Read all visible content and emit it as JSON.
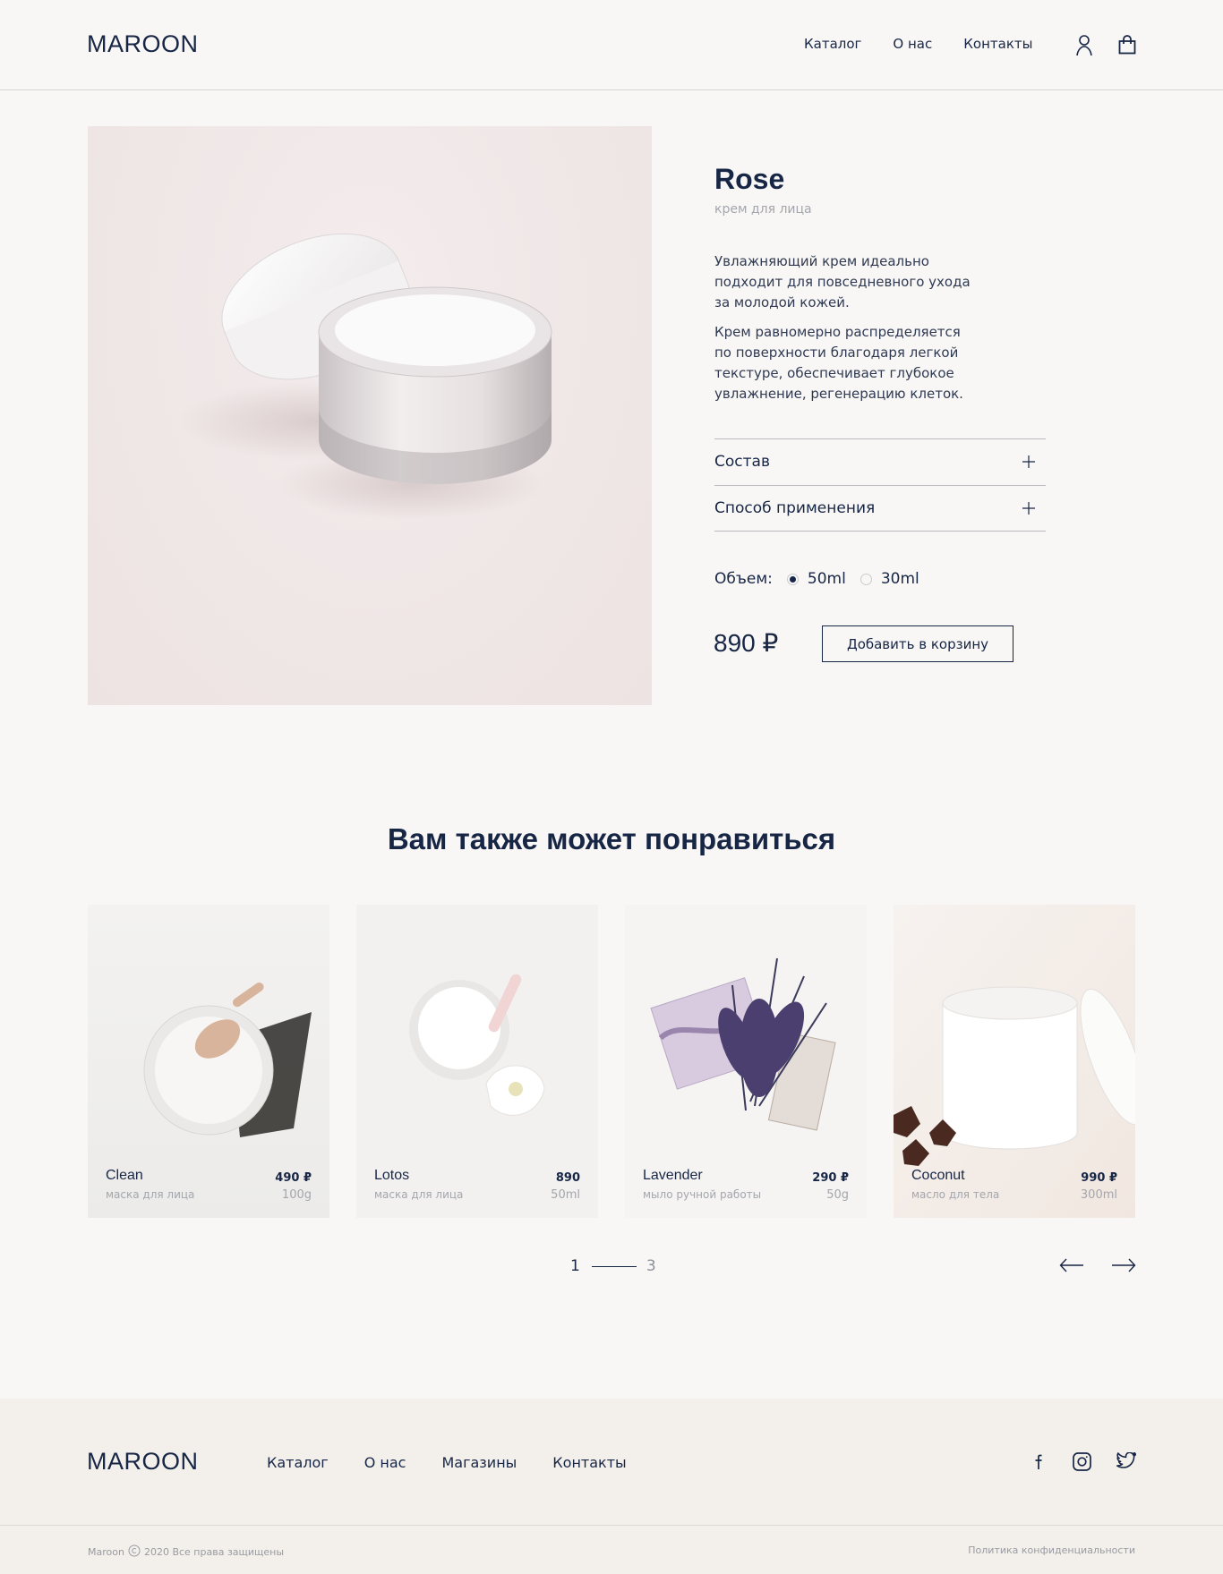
{
  "brand": {
    "logo": "MAROON"
  },
  "header": {
    "nav": [
      "Каталог",
      "О нас",
      "Контакты"
    ],
    "icons": [
      "user-icon",
      "shopping-bag-icon"
    ]
  },
  "product": {
    "title": "Rose",
    "subtitle": "крем для лица",
    "desc1": "Увлажняющий крем идеально подходит для повседневного ухода за молодой кожей.",
    "desc2": "Крем равномерно распределяется по поверхности благодаря легкой текстуре, обеспечивает глубокое увлажнение, регенерацию клеток.",
    "accordion": [
      "Состав",
      "Способ применения"
    ],
    "volume_label": "Объем:",
    "volumes": [
      "50ml",
      "30ml"
    ],
    "selected_volume": "50ml",
    "price": "890 ₽",
    "add_to_cart": "Добавить в корзину"
  },
  "recommend": {
    "title": "Вам также может понравиться",
    "cards": [
      {
        "name": "Clean",
        "type": "маска для лица",
        "price": "490 ₽",
        "size": "100g"
      },
      {
        "name": "Lotos",
        "type": "маска для лица",
        "price": "890",
        "size": "50ml"
      },
      {
        "name": "Lavender",
        "type": "мыло ручной работы",
        "price": "290 ₽",
        "size": "50g"
      },
      {
        "name": "Coconut",
        "type": "масло для тела",
        "price": "990 ₽",
        "size": "300ml"
      }
    ],
    "pager": {
      "current": "1",
      "total": "3"
    }
  },
  "footer": {
    "logo": "MAROON",
    "nav": [
      "Каталог",
      "О нас",
      "Магазины",
      "Контакты"
    ],
    "social": [
      "facebook-icon",
      "instagram-icon",
      "twitter-icon"
    ],
    "copyright_brand": "Maroon",
    "copyright_text": "2020 Все права защищены",
    "privacy": "Политика конфиденциальности"
  },
  "colors": {
    "text": "#172645",
    "muted": "#a3a6ad",
    "bg": "#f8f7f5",
    "footer_bg": "#f3f0ec"
  }
}
